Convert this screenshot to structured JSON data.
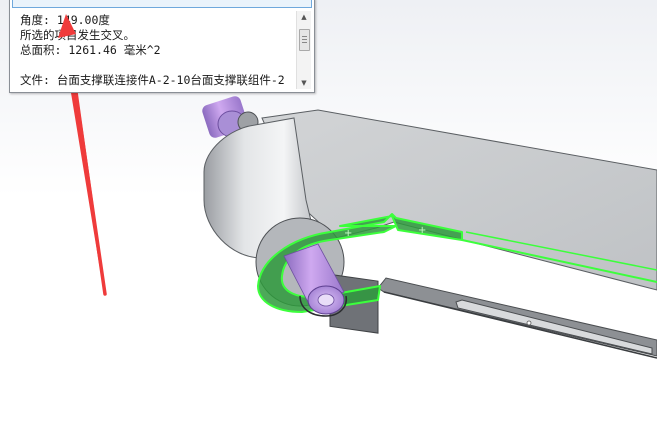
{
  "measure_panel": {
    "angle_line": "角度: 149.00度",
    "intersect_line": "所选的项目发生交叉。",
    "area_line": "总面积: 1261.46 毫米^2",
    "file_line": "文件: 台面支撑联连接件A-2-10台面支撑联组件-2"
  },
  "colors": {
    "selection_highlight": "#35d43a",
    "selection_fill": "#2c9a3a",
    "pin_purple": "#b58ae0",
    "arrow_red": "#ef3b3b",
    "part_gray": "#c4c8cc"
  },
  "icons": {
    "scroll_up": "triangle-up",
    "scroll_down": "triangle-down"
  }
}
